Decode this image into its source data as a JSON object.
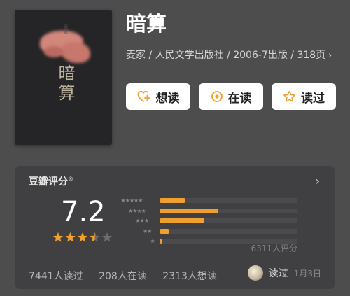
{
  "book": {
    "cover_title": "暗算",
    "cover_small_text": "麦家",
    "title": "暗算",
    "meta": "麦家 / 人民文学出版社 / 2006-7出版 / 318页",
    "meta_chevron": "›"
  },
  "actions": [
    {
      "label": "想读",
      "icon": "heart-plus-icon"
    },
    {
      "label": "在读",
      "icon": "target-circle-icon"
    },
    {
      "label": "读过",
      "icon": "star-outline-icon"
    }
  ],
  "rating": {
    "section_title": "豆瓣评分",
    "trademark": "®",
    "score": "7.2",
    "stars": 3.5,
    "distribution": [
      {
        "stars": 5,
        "label": "★★★★★",
        "percent": 18
      },
      {
        "stars": 4,
        "label": "★★★★",
        "percent": 42
      },
      {
        "stars": 3,
        "label": "★★★",
        "percent": 32
      },
      {
        "stars": 2,
        "label": "★★",
        "percent": 6
      },
      {
        "stars": 1,
        "label": "★",
        "percent": 1.5
      }
    ],
    "count_text": "6311人评分",
    "arrow": "›"
  },
  "stats": {
    "read": "7441人读过",
    "reading": "208人在读",
    "want": "2313人想读"
  },
  "my_status": {
    "label": "读过",
    "date": "1月3日"
  },
  "colors": {
    "background": "#4d4d4e",
    "card": "#404042",
    "accent": "#f0a02c",
    "button": "#ffffff"
  }
}
